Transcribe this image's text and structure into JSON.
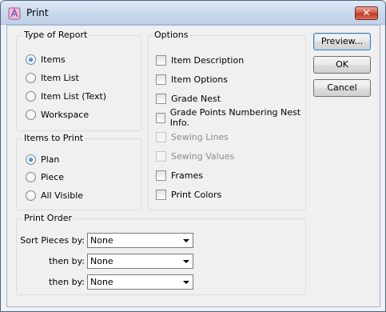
{
  "window": {
    "title": "Print",
    "close_label": "✕"
  },
  "report_type": {
    "title": "Type of Report",
    "options": [
      "Items",
      "Item List",
      "Item List (Text)",
      "Workspace"
    ],
    "selected": "Items"
  },
  "items_to_print": {
    "title": "Items to Print",
    "options": [
      "Plan",
      "Piece",
      "All Visible"
    ],
    "selected": "Plan"
  },
  "options": {
    "title": "Options",
    "items": [
      {
        "label": "Item Description",
        "checked": false,
        "enabled": true
      },
      {
        "label": "Item Options",
        "checked": false,
        "enabled": true
      },
      {
        "label": "Grade Nest",
        "checked": false,
        "enabled": true
      },
      {
        "label": "Grade Points Numbering Nest Info.",
        "checked": false,
        "enabled": true
      },
      {
        "label": "Sewing Lines",
        "checked": false,
        "enabled": false
      },
      {
        "label": "Sewing Values",
        "checked": false,
        "enabled": false
      },
      {
        "label": "Frames",
        "checked": false,
        "enabled": true
      },
      {
        "label": "Print Colors",
        "checked": false,
        "enabled": true
      }
    ]
  },
  "buttons": {
    "preview": "Preview...",
    "ok": "OK",
    "cancel": "Cancel"
  },
  "print_order": {
    "title": "Print Order",
    "rows": [
      {
        "label": "Sort Pieces by:",
        "value": "None"
      },
      {
        "label": "then by:",
        "value": "None"
      },
      {
        "label": "then by:",
        "value": "None"
      }
    ]
  },
  "icons": {
    "app": "print-app-icon",
    "close": "close-icon"
  },
  "colors": {
    "radio_selected": "#1f6fc4",
    "close_button": "#c0392b",
    "disabled_text": "#8d8d8d"
  }
}
